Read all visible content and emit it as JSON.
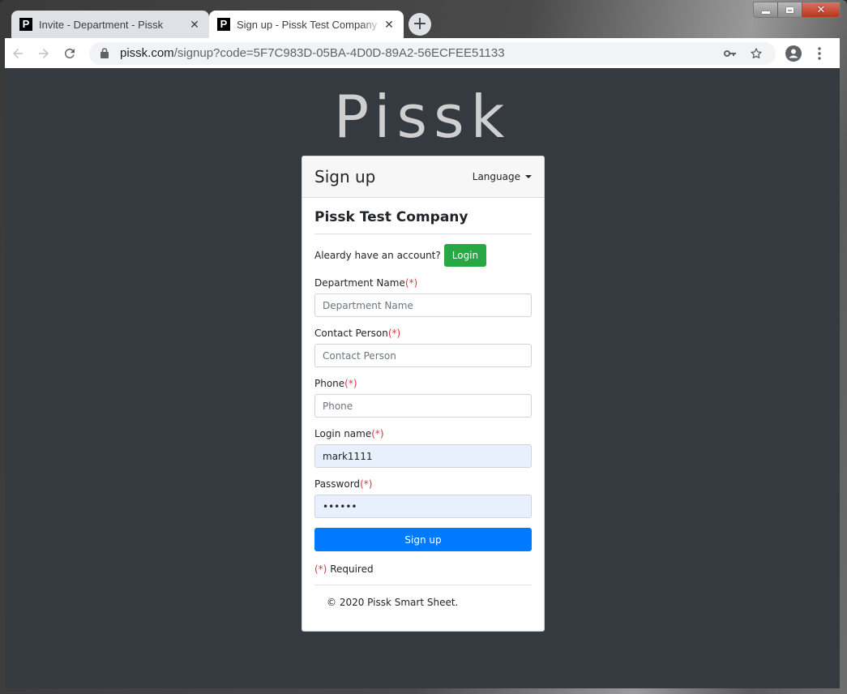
{
  "window": {
    "controls": {
      "minimize": "minimize",
      "maximize": "maximize",
      "close": "✕"
    }
  },
  "browser": {
    "tabs": [
      {
        "title": "Invite - Department - Pissk",
        "favicon": "P",
        "active": false
      },
      {
        "title": "Sign up - Pissk Test Company",
        "favicon": "P",
        "active": true
      }
    ],
    "tab_close_glyph": "✕",
    "new_tab_glyph": "+",
    "url_host": "pissk.com",
    "url_path": "/signup?code=5F7C983D-05BA-4D0D-89A2-56ECFEE51133",
    "icons": [
      "back-icon",
      "forward-icon",
      "reload-icon",
      "lock-icon",
      "key-icon",
      "star-icon",
      "profile-icon",
      "menu-icon"
    ]
  },
  "page": {
    "brand": "Pissk",
    "card": {
      "title": "Sign up",
      "language_label": "Language",
      "company": "Pissk Test Company",
      "login_prompt": "Aleardy have an account?",
      "login_button": "Login",
      "fields": [
        {
          "label": "Department Name",
          "required_mark": "(*)",
          "placeholder": "Department Name",
          "value": ""
        },
        {
          "label": "Contact Person",
          "required_mark": "(*)",
          "placeholder": "Contact Person",
          "value": ""
        },
        {
          "label": "Phone",
          "required_mark": "(*)",
          "placeholder": "Phone",
          "value": ""
        },
        {
          "label": "Login name",
          "required_mark": "(*)",
          "placeholder": "",
          "value": "mark1111"
        },
        {
          "label": "Password",
          "required_mark": "(*)",
          "placeholder": "",
          "value": "••••••"
        }
      ],
      "submit_button": "Sign up",
      "required_note_mark": "(*)",
      "required_note_text": " Required",
      "copyright": "© 2020 Pissk Smart Sheet."
    }
  },
  "colors": {
    "page_bg": "#343a40",
    "login_btn": "#28a745",
    "signup_btn": "#007bff",
    "required": "#dc3545",
    "autofill_bg": "#e8f0fe"
  }
}
